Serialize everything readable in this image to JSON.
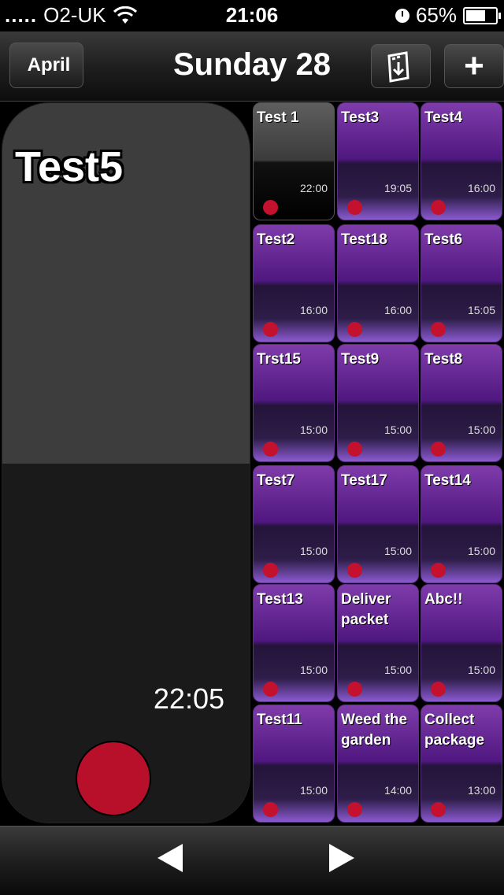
{
  "status_bar": {
    "signal": ".....",
    "carrier": "O2-UK",
    "time": "21:06",
    "battery": "65%"
  },
  "nav": {
    "back_label": "April",
    "title": "Sunday 28",
    "add_label": "+"
  },
  "detail": {
    "title": "Test5",
    "time": "22:05",
    "colors": {
      "top": "#3d3d3d",
      "bottom": "#1a1a1a",
      "dot": "#b80f2a"
    }
  },
  "tiles": [
    {
      "title": "Test 1",
      "time": "22:00",
      "style": "grey"
    },
    {
      "title": "Test3",
      "time": "19:05",
      "style": "purple"
    },
    {
      "title": "Test4",
      "time": "16:00",
      "style": "purple"
    },
    {
      "title": "Test2",
      "time": "16:00",
      "style": "purple"
    },
    {
      "title": "Test18",
      "time": "16:00",
      "style": "purple"
    },
    {
      "title": "Test6",
      "time": "15:05",
      "style": "purple"
    },
    {
      "title": "Trst15",
      "time": "15:00",
      "style": "purple"
    },
    {
      "title": "Test9",
      "time": "15:00",
      "style": "purple"
    },
    {
      "title": "Test8",
      "time": "15:00",
      "style": "purple"
    },
    {
      "title": "Test7",
      "time": "15:00",
      "style": "purple"
    },
    {
      "title": "Test17",
      "time": "15:00",
      "style": "purple"
    },
    {
      "title": "Test14",
      "time": "15:00",
      "style": "purple"
    },
    {
      "title": "Test13",
      "time": "15:00",
      "style": "purple"
    },
    {
      "title": "Deliver packet",
      "time": "15:00",
      "style": "purple"
    },
    {
      "title": "Abc!!",
      "time": "15:00",
      "style": "purple"
    },
    {
      "title": "Test11",
      "time": "15:00",
      "style": "purple"
    },
    {
      "title": "Weed the garden",
      "time": "14:00",
      "style": "purple"
    },
    {
      "title": "Collect package",
      "time": "13:00",
      "style": "purple"
    }
  ],
  "toolbar": {
    "prev_icon": "triangle-left-icon",
    "next_icon": "triangle-right-icon"
  },
  "colors": {
    "tile_purple": "#5a1e8a",
    "dot_red": "#c4112e"
  }
}
